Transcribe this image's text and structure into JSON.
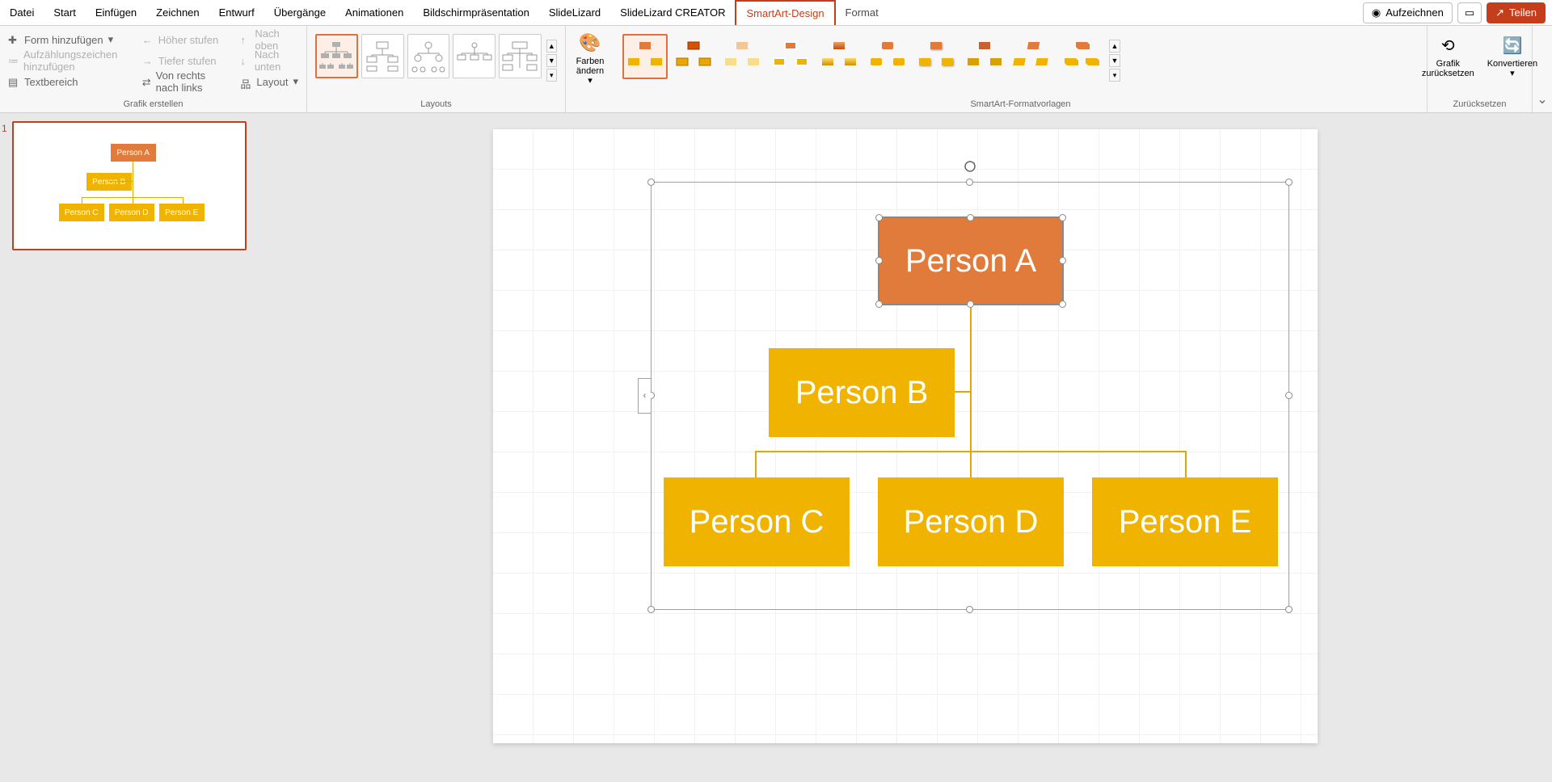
{
  "menu": {
    "tabs": [
      "Datei",
      "Start",
      "Einfügen",
      "Zeichnen",
      "Entwurf",
      "Übergänge",
      "Animationen",
      "Bildschirmpräsentation",
      "SlideLizard",
      "SlideLizard CREATOR"
    ],
    "context_active": "SmartArt-Design",
    "context_other": "Format",
    "record": "Aufzeichnen",
    "share": "Teilen"
  },
  "ribbon": {
    "grafik": {
      "label": "Grafik erstellen",
      "add_shape": "Form hinzufügen",
      "add_bullet": "Aufzählungszeichen hinzufügen",
      "textpane": "Textbereich",
      "promote": "Höher stufen",
      "demote": "Tiefer stufen",
      "rtl": "Von rechts nach links",
      "move_up": "Nach oben",
      "move_down": "Nach unten",
      "layout_btn": "Layout"
    },
    "layouts": {
      "label": "Layouts"
    },
    "colors": {
      "label": "Farben",
      "line2": "ändern"
    },
    "styles": {
      "label": "SmartArt-Formatvorlagen"
    },
    "reset": {
      "label": "Zurücksetzen",
      "reset_graphic": "Grafik",
      "reset_graphic2": "zurücksetzen",
      "convert": "Konvertieren"
    }
  },
  "thumb": {
    "slide_num": "1"
  },
  "org": {
    "a": "Person A",
    "b": "Person B",
    "c": "Person C",
    "d": "Person D",
    "e": "Person E"
  },
  "colors": {
    "accent_orange": "#e07b3c",
    "accent_yellow": "#f0b400",
    "brand_red": "#c43e1c"
  },
  "chart_data": {
    "type": "org-chart",
    "nodes": [
      {
        "id": "A",
        "label": "Person A",
        "parent": null,
        "color": "#e07b3c"
      },
      {
        "id": "B",
        "label": "Person B",
        "parent": "A",
        "color": "#f0b400",
        "assistant": true
      },
      {
        "id": "C",
        "label": "Person C",
        "parent": "A",
        "color": "#f0b400"
      },
      {
        "id": "D",
        "label": "Person D",
        "parent": "A",
        "color": "#f0b400"
      },
      {
        "id": "E",
        "label": "Person E",
        "parent": "A",
        "color": "#f0b400"
      }
    ]
  }
}
